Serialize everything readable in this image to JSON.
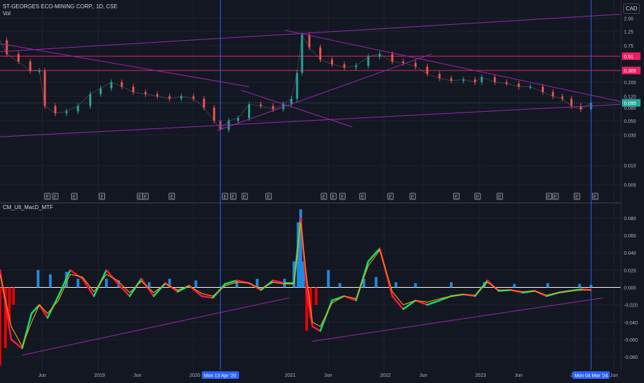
{
  "header": {
    "symbol_line": "ST-GEORGES ECO-MINING CORP., 1D, CSE",
    "volume_label": "Vol",
    "currency": "CAD"
  },
  "indicator": {
    "name": "CM_Ult_MacD_MTF"
  },
  "colors": {
    "background": "#131722",
    "grid": "#1e222d",
    "candle_up": "#26a69a",
    "candle_down": "#ef5350",
    "trendline": "#9c27b0",
    "level_line": "#e91e63",
    "date_marker": "#2962ff",
    "macd_fast_up": "#00e676",
    "macd_fast_down": "#ff1744",
    "macd_slow": "#ff9800",
    "hist_up": "#2196f3",
    "hist_down": "#ff0000",
    "zero_line": "#ffffff"
  },
  "chart_data": [
    {
      "type": "line",
      "title": "ST-GEORGES ECO-MINING CORP., 1D, CSE",
      "price_scale": "log",
      "ylim": [
        0.0035,
        3.0
      ],
      "price_ticks": [
        "2.00",
        "1.25",
        "0.75",
        "0.51",
        "0.305",
        "0.200",
        "0.120",
        "0.095",
        "0.080",
        "0.050",
        "0.030",
        "0.010",
        "0.005"
      ],
      "price_tick_values": [
        2.0,
        1.25,
        0.75,
        0.51,
        0.305,
        0.2,
        0.12,
        0.095,
        0.08,
        0.05,
        0.03,
        0.01,
        0.005
      ],
      "highlighted_levels": [
        {
          "label": "0.51",
          "value": 0.51,
          "color": "#e91e63"
        },
        {
          "label": "0.305",
          "value": 0.305,
          "color": "#e91e63"
        },
        {
          "label": "0.095",
          "value": 0.095,
          "color": "#26a69a"
        }
      ],
      "x_ticks": [
        "Jun",
        "2019",
        "Jun",
        "2020",
        "2021",
        "Jun",
        "2022",
        "Jun",
        "2023",
        "Jun",
        "2024",
        "Jun"
      ],
      "x_tick_dates": [
        "2018-06-01",
        "2019-01-01",
        "2019-06-01",
        "2020-01-01",
        "2021-01-01",
        "2021-06-01",
        "2022-01-01",
        "2022-06-01",
        "2023-01-01",
        "2023-06-01",
        "2024-01-01",
        "2024-06-01"
      ],
      "date_markers": [
        {
          "label": "Mon 13 Apr '20",
          "date": "2020-04-13"
        },
        {
          "label": "Mon 04 Mar '24",
          "date": "2024-03-04"
        }
      ],
      "price_series": {
        "dates": [
          "2017-12-20",
          "2018-01-15",
          "2018-03-01",
          "2018-04-15",
          "2018-05-20",
          "2018-06-10",
          "2018-07-20",
          "2018-09-01",
          "2018-10-15",
          "2018-12-01",
          "2019-01-10",
          "2019-02-20",
          "2019-04-01",
          "2019-05-15",
          "2019-07-01",
          "2019-08-15",
          "2019-10-01",
          "2019-11-15",
          "2020-01-01",
          "2020-02-10",
          "2020-03-20",
          "2020-04-13",
          "2020-05-15",
          "2020-06-20",
          "2020-08-01",
          "2020-09-15",
          "2020-11-01",
          "2020-12-10",
          "2021-01-10",
          "2021-02-01",
          "2021-02-20",
          "2021-03-20",
          "2021-05-01",
          "2021-06-15",
          "2021-08-01",
          "2021-09-15",
          "2021-11-01",
          "2021-12-15",
          "2022-02-01",
          "2022-03-15",
          "2022-05-01",
          "2022-06-15",
          "2022-08-01",
          "2022-09-15",
          "2022-11-01",
          "2022-12-15",
          "2023-01-10",
          "2023-03-01",
          "2023-04-15",
          "2023-06-01",
          "2023-07-15",
          "2023-09-01",
          "2023-10-10",
          "2023-11-15",
          "2023-12-20",
          "2024-01-25",
          "2024-03-04"
        ],
        "close": [
          0.9,
          0.55,
          0.42,
          0.3,
          0.3,
          0.085,
          0.065,
          0.07,
          0.085,
          0.13,
          0.16,
          0.2,
          0.17,
          0.14,
          0.13,
          0.12,
          0.11,
          0.12,
          0.11,
          0.08,
          0.05,
          0.036,
          0.05,
          0.055,
          0.09,
          0.085,
          0.075,
          0.09,
          0.11,
          0.28,
          1.1,
          0.7,
          0.45,
          0.38,
          0.34,
          0.36,
          0.5,
          0.55,
          0.42,
          0.4,
          0.35,
          0.27,
          0.23,
          0.21,
          0.22,
          0.2,
          0.24,
          0.2,
          0.19,
          0.17,
          0.17,
          0.14,
          0.12,
          0.11,
          0.085,
          0.075,
          0.095
        ]
      },
      "trendlines": [
        {
          "from": {
            "date": "2017-12-20",
            "value": 0.028
          },
          "to": {
            "date": "2024-06-25",
            "value": 0.09
          }
        },
        {
          "from": {
            "date": "2017-12-20",
            "value": 0.6
          },
          "to": {
            "date": "2024-06-25",
            "value": 2.3
          }
        },
        {
          "from": {
            "date": "2017-12-20",
            "value": 0.8
          },
          "to": {
            "date": "2020-08-01",
            "value": 0.17
          }
        },
        {
          "from": {
            "date": "2020-04-01",
            "value": 0.035
          },
          "to": {
            "date": "2022-07-01",
            "value": 0.55
          }
        },
        {
          "from": {
            "date": "2020-07-01",
            "value": 0.15
          },
          "to": {
            "date": "2021-09-01",
            "value": 0.04
          }
        },
        {
          "from": {
            "date": "2020-12-15",
            "value": 1.3
          },
          "to": {
            "date": "2024-06-25",
            "value": 0.1
          }
        }
      ],
      "volume_markers": "E"
    },
    {
      "type": "line",
      "title": "CM_Ult_MacD_MTF",
      "ylim": [
        -0.095,
        0.095
      ],
      "y_ticks": [
        "0.080",
        "0.060",
        "0.040",
        "0.020",
        "0.000",
        "-0.020",
        "-0.040",
        "-0.060",
        "-0.080"
      ],
      "y_tick_values": [
        0.08,
        0.06,
        0.04,
        0.02,
        0.0,
        -0.02,
        -0.04,
        -0.06,
        -0.08
      ],
      "series": [
        {
          "dates": [
            "2017-12-20",
            "2018-02-01",
            "2018-03-15",
            "2018-04-20",
            "2018-05-20",
            "2018-06-20",
            "2018-08-01",
            "2018-09-15",
            "2018-11-01",
            "2018-12-15",
            "2019-02-01",
            "2019-03-15",
            "2019-05-01",
            "2019-06-15",
            "2019-08-01",
            "2019-09-15",
            "2019-11-01",
            "2019-12-15",
            "2020-02-01",
            "2020-03-15",
            "2020-05-01",
            "2020-06-15",
            "2020-08-01",
            "2020-09-15",
            "2020-11-01",
            "2020-12-15",
            "2021-01-20",
            "2021-02-15",
            "2021-03-10",
            "2021-04-01",
            "2021-05-01",
            "2021-06-15",
            "2021-08-01",
            "2021-09-15",
            "2021-11-01",
            "2021-12-15",
            "2022-02-01",
            "2022-03-15",
            "2022-05-01",
            "2022-06-15",
            "2022-08-01",
            "2022-09-15",
            "2022-11-01",
            "2022-12-15",
            "2023-02-01",
            "2023-03-15",
            "2023-05-01",
            "2023-06-15",
            "2023-08-01",
            "2023-09-15",
            "2023-11-01",
            "2023-12-15",
            "2024-02-01",
            "2024-03-04"
          ],
          "values": [
            0.02,
            -0.06,
            -0.07,
            -0.03,
            -0.02,
            -0.035,
            -0.01,
            0.02,
            0.01,
            -0.01,
            0.02,
            0.005,
            -0.01,
            0.01,
            -0.01,
            0.005,
            -0.005,
            0.002,
            -0.01,
            -0.012,
            0.004,
            0.008,
            0.005,
            -0.003,
            0.008,
            0.005,
            0.005,
            0.08,
            -0.005,
            -0.045,
            -0.05,
            -0.015,
            -0.01,
            -0.015,
            0.03,
            0.045,
            -0.01,
            -0.025,
            -0.015,
            -0.02,
            -0.015,
            -0.01,
            -0.008,
            -0.01,
            0.008,
            -0.004,
            -0.003,
            -0.006,
            -0.004,
            -0.01,
            -0.006,
            -0.004,
            -0.002,
            -0.003
          ]
        },
        {
          "dates": [
            "2017-12-20",
            "2018-02-01",
            "2018-03-15",
            "2018-04-20",
            "2018-05-20",
            "2018-06-20",
            "2018-08-01",
            "2018-09-15",
            "2018-11-01",
            "2018-12-15",
            "2019-02-01",
            "2019-03-15",
            "2019-05-01",
            "2019-06-15",
            "2019-08-01",
            "2019-09-15",
            "2019-11-01",
            "2019-12-15",
            "2020-02-01",
            "2020-03-15",
            "2020-05-01",
            "2020-06-15",
            "2020-08-01",
            "2020-09-15",
            "2020-11-01",
            "2020-12-15",
            "2021-01-20",
            "2021-02-15",
            "2021-03-10",
            "2021-04-01",
            "2021-05-01",
            "2021-06-15",
            "2021-08-01",
            "2021-09-15",
            "2021-11-01",
            "2021-12-15",
            "2022-02-01",
            "2022-03-15",
            "2022-05-01",
            "2022-06-15",
            "2022-08-01",
            "2022-09-15",
            "2022-11-01",
            "2022-12-15",
            "2023-02-01",
            "2023-03-15",
            "2023-05-01",
            "2023-06-15",
            "2023-08-01",
            "2023-09-15",
            "2023-11-01",
            "2023-12-15",
            "2024-02-01",
            "2024-03-04"
          ],
          "values": [
            0.015,
            -0.045,
            -0.068,
            -0.04,
            -0.02,
            -0.03,
            -0.015,
            0.015,
            0.012,
            -0.005,
            0.015,
            0.008,
            -0.006,
            0.007,
            -0.006,
            0.004,
            -0.003,
            0.002,
            -0.007,
            -0.01,
            0.002,
            0.006,
            0.005,
            -0.002,
            0.006,
            0.004,
            0.004,
            0.075,
            0.01,
            -0.04,
            -0.045,
            -0.018,
            -0.01,
            -0.013,
            0.025,
            0.043,
            -0.005,
            -0.02,
            -0.015,
            -0.017,
            -0.013,
            -0.01,
            -0.008,
            -0.009,
            0.006,
            -0.003,
            -0.003,
            -0.005,
            -0.004,
            -0.009,
            -0.006,
            -0.004,
            -0.003,
            -0.003
          ]
        }
      ],
      "histogram": {
        "dates": [
          "2017-12-20",
          "2018-01-10",
          "2018-01-25",
          "2018-02-10",
          "2018-05-15",
          "2018-07-01",
          "2018-09-01",
          "2018-10-15",
          "2019-02-01",
          "2019-03-20",
          "2019-07-15",
          "2019-10-01",
          "2020-01-10",
          "2020-06-15",
          "2020-09-01",
          "2020-12-15",
          "2021-01-20",
          "2021-02-05",
          "2021-02-15",
          "2021-02-25",
          "2021-03-10",
          "2021-03-25",
          "2021-04-15",
          "2021-06-01",
          "2021-07-15",
          "2021-10-15",
          "2021-12-01",
          "2022-02-15",
          "2022-05-01",
          "2022-09-15",
          "2023-01-20",
          "2023-05-15",
          "2023-09-20",
          "2024-01-20",
          "2024-03-04"
        ],
        "values": [
          -0.09,
          -0.07,
          -0.04,
          -0.02,
          0.02,
          0.015,
          0.018,
          0.01,
          0.01,
          0.008,
          0.006,
          0.01,
          0.008,
          0.008,
          0.01,
          0.01,
          0.03,
          0.075,
          0.09,
          0.03,
          -0.05,
          -0.035,
          -0.02,
          0.02,
          0.005,
          0.01,
          0.012,
          0.006,
          0.005,
          0.006,
          0.006,
          0.004,
          0.005,
          0.004,
          0.003
        ]
      },
      "trendlines": [
        {
          "from": {
            "date": "2018-03-15",
            "value": -0.078
          },
          "to": {
            "date": "2021-01-01",
            "value": -0.012
          }
        },
        {
          "from": {
            "date": "2021-04-01",
            "value": -0.062
          },
          "to": {
            "date": "2024-04-20",
            "value": -0.012
          }
        }
      ]
    }
  ]
}
